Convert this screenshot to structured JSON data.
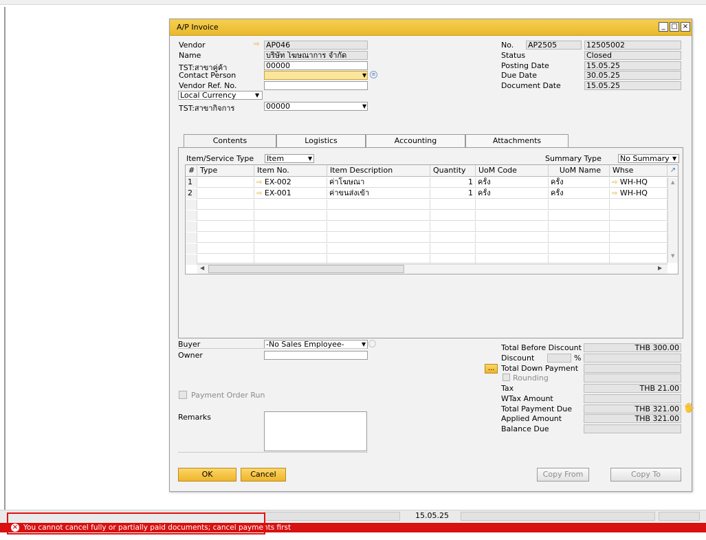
{
  "window": {
    "title": "A/P Invoice",
    "btn_min": "_",
    "btn_max": "□",
    "btn_close": "×"
  },
  "header_left": {
    "vendor_label": "Vendor",
    "vendor_value": "AP046",
    "name_label": "Name",
    "name_value": "บริษัท โฆษณาการ จำกัด",
    "tst_branch_label": "TST:สาขาคู่ค้า",
    "tst_branch_value": "00000",
    "contact_label": "Contact Person",
    "contact_value": "",
    "vendor_ref_label": "Vendor Ref. No.",
    "vendor_ref_value": "",
    "currency_select": "Local Currency",
    "tst_biz_label": "TST:สาขากิจการ",
    "tst_biz_value": "00000"
  },
  "header_right": {
    "no_label": "No.",
    "series": "AP2505",
    "doc_no": "12505002",
    "status_label": "Status",
    "status_value": "Closed",
    "posting_label": "Posting Date",
    "posting_value": "15.05.25",
    "due_label": "Due Date",
    "due_value": "30.05.25",
    "docdate_label": "Document Date",
    "docdate_value": "15.05.25"
  },
  "tabs": [
    "Contents",
    "Logistics",
    "Accounting",
    "Attachments"
  ],
  "contents": {
    "item_type_label": "Item/Service Type",
    "item_type_value": "Item",
    "summary_label": "Summary Type",
    "summary_value": "No Summary",
    "columns": [
      "#",
      "Type",
      "Item No.",
      "Item Description",
      "Quantity",
      "UoM Code",
      "UoM Name",
      "Whse"
    ],
    "rows": [
      {
        "num": "1",
        "type": "",
        "item_no": "EX-002",
        "desc": "ค่าโฆษณา",
        "qty": "1",
        "uom_code": "ครั้ง",
        "uom_name": "ครั้ง",
        "whse": "WH-HQ"
      },
      {
        "num": "2",
        "type": "",
        "item_no": "EX-001",
        "desc": "ค่าขนส่งเข้า",
        "qty": "1",
        "uom_code": "ครั้ง",
        "uom_name": "ครั้ง",
        "whse": "WH-HQ"
      }
    ],
    "scroll_left": "◀",
    "scroll_right": "▶"
  },
  "footer_left": {
    "buyer_label": "Buyer",
    "buyer_value": "-No Sales Employee-",
    "owner_label": "Owner",
    "owner_value": "",
    "payment_order_label": "Payment Order Run",
    "remarks_label": "Remarks",
    "remarks_value": ""
  },
  "totals": {
    "before_discount_label": "Total Before Discount",
    "before_discount_value": "THB 300.00",
    "discount_label": "Discount",
    "discount_pct": "",
    "discount_pct_sign": "%",
    "discount_value": "",
    "down_payment_btn": "...",
    "down_payment_label": "Total Down Payment",
    "down_payment_value": "",
    "rounding_label": "Rounding",
    "rounding_value": "",
    "tax_label": "Tax",
    "tax_value": "THB 21.00",
    "wtax_label": "WTax Amount",
    "wtax_value": "",
    "total_due_label": "Total Payment Due",
    "total_due_value": "THB 321.00",
    "applied_label": "Applied Amount",
    "applied_value": "THB 321.00",
    "balance_label": "Balance Due",
    "balance_value": ""
  },
  "buttons": {
    "ok": "OK",
    "cancel": "Cancel",
    "copy_from": "Copy From",
    "copy_to": "Copy To"
  },
  "statusbar": {
    "date": "15.05.25",
    "error": "You cannot cancel fully or partially paid documents; cancel payments first"
  },
  "colors": {
    "title_bar": "#e9b92a",
    "error_bar": "#d81111",
    "mandatory_field": "#fbe59a",
    "accent_arrow": "#e5a720"
  }
}
